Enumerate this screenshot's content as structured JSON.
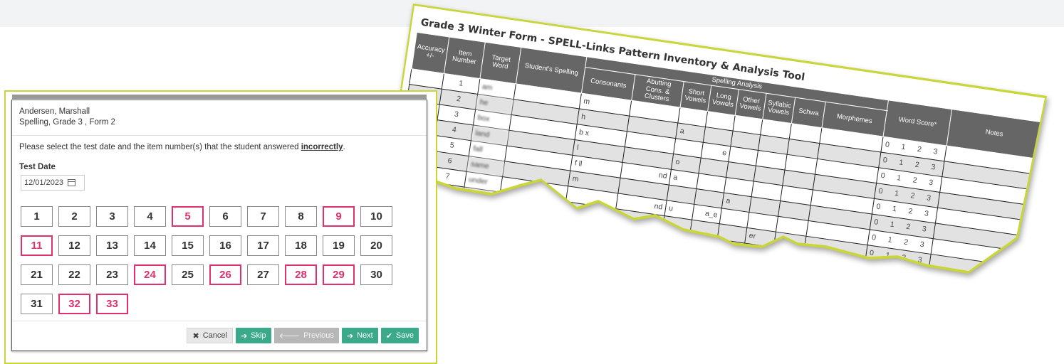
{
  "colors": {
    "accent": "#c9d63a",
    "selected": "#e0306e",
    "primary_button": "#3aaa8a"
  },
  "sheet": {
    "title": "Grade 3 Winter Form - SPELL-Links Pattern Inventory & Analysis Tool",
    "headers": {
      "accuracy": "Accuracy +/-",
      "item_number": "Item Number",
      "target_word": "Target Word",
      "spelling_analysis": "Spelling Analysis",
      "students_spelling": "Student's Spelling",
      "consonants": "Consonants",
      "abutting": "Abutting Cons. & Clusters",
      "short_vowels": "Short Vowels",
      "long_vowels": "Long Vowels",
      "other_vowels": "Other Vowels",
      "syllabic_vowels": "Syllabic Vowels",
      "schwa": "Schwa",
      "morphemes": "Morphemes",
      "word_score": "Word Score*",
      "notes": "Notes"
    },
    "rows": [
      {
        "n": "1",
        "word": "am",
        "cons": "m",
        "abut": "",
        "short": "",
        "long": "",
        "other": "",
        "syl": "",
        "score": "0 1 2 3"
      },
      {
        "n": "2",
        "word": "he",
        "cons": "h",
        "abut": "",
        "short": "a",
        "long": "",
        "other": "",
        "syl": "",
        "score": "0 1 2 3"
      },
      {
        "n": "3",
        "word": "box",
        "cons": "b   x",
        "abut": "",
        "short": "",
        "long": "e",
        "other": "",
        "syl": "",
        "score": "0 1 2 3"
      },
      {
        "n": "4",
        "word": "land",
        "cons": "l",
        "abut": "",
        "short": "o",
        "long": "",
        "other": "",
        "syl": "",
        "score": "0 1 2 3"
      },
      {
        "n": "5",
        "word": "fall",
        "cons": "f   ll",
        "abut": "nd",
        "short": "a",
        "long": "",
        "other": "",
        "syl": "",
        "score": "0 1 2 3"
      },
      {
        "n": "6",
        "word": "same",
        "cons": "m",
        "abut": "",
        "short": "",
        "long": "",
        "other": "a",
        "syl": "",
        "score": "0 1 2 3"
      },
      {
        "n": "7",
        "word": "under",
        "cons": "",
        "abut": "nd",
        "short": "u",
        "long": "a_e",
        "other": "",
        "syl": "",
        "score": "0 1 2 3"
      },
      {
        "n": "",
        "word": "",
        "cons": "",
        "abut": "",
        "short": "",
        "long": "",
        "other": "",
        "syl": "er",
        "score": "0 1 2 3"
      }
    ]
  },
  "modal": {
    "student_name": "Andersen, Marshall",
    "test_name": "Spelling, Grade 3 , Form 2",
    "instruction_prefix": "Please select the test date and the item number(s) that the student answered ",
    "instruction_emph": "incorrectly",
    "instruction_suffix": ".",
    "test_date_label": "Test Date",
    "test_date_value": "12/01/2023",
    "items": [
      {
        "label": "1",
        "sel": false
      },
      {
        "label": "2",
        "sel": false
      },
      {
        "label": "3",
        "sel": false
      },
      {
        "label": "4",
        "sel": false
      },
      {
        "label": "5",
        "sel": true
      },
      {
        "label": "6",
        "sel": false
      },
      {
        "label": "7",
        "sel": false
      },
      {
        "label": "8",
        "sel": false
      },
      {
        "label": "9",
        "sel": true
      },
      {
        "label": "10",
        "sel": false
      },
      {
        "label": "11",
        "sel": true
      },
      {
        "label": "12",
        "sel": false
      },
      {
        "label": "13",
        "sel": false
      },
      {
        "label": "14",
        "sel": false
      },
      {
        "label": "15",
        "sel": false
      },
      {
        "label": "16",
        "sel": false
      },
      {
        "label": "17",
        "sel": false
      },
      {
        "label": "18",
        "sel": false
      },
      {
        "label": "19",
        "sel": false
      },
      {
        "label": "20",
        "sel": false
      },
      {
        "label": "21",
        "sel": false
      },
      {
        "label": "22",
        "sel": false
      },
      {
        "label": "23",
        "sel": false
      },
      {
        "label": "24",
        "sel": true
      },
      {
        "label": "25",
        "sel": false
      },
      {
        "label": "26",
        "sel": true
      },
      {
        "label": "27",
        "sel": false
      },
      {
        "label": "28",
        "sel": true
      },
      {
        "label": "29",
        "sel": true
      },
      {
        "label": "30",
        "sel": false
      },
      {
        "label": "31",
        "sel": false
      },
      {
        "label": "32",
        "sel": true
      },
      {
        "label": "33",
        "sel": true
      }
    ],
    "buttons": {
      "cancel": "Cancel",
      "skip": "Skip",
      "previous": "Previous",
      "next": "Next",
      "save": "Save"
    },
    "icons": {
      "cancel": "close-icon",
      "skip": "arrow-right-icon",
      "previous": "arrow-left-icon",
      "next": "arrow-right-icon",
      "save": "check-icon",
      "date": "calendar-icon"
    }
  }
}
